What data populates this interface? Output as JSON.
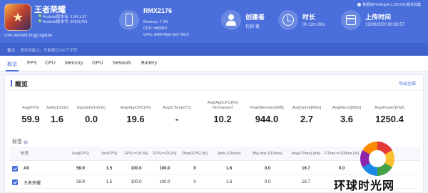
{
  "header": {
    "app": {
      "name": "王者荣耀",
      "android_version": "Android版本名: 1.54.1.37",
      "android_code": "Android版本号: 54011701",
      "package": "com.tencent.tmgp.sgame"
    },
    "device": {
      "model": "RMX2176",
      "memory": "Memory: 7.4G",
      "cpu": "CPU: mt6853",
      "gpu": "GPU: ARM Mali-G57 MC3"
    },
    "creator": {
      "label": "创建者",
      "value": "包剑·客"
    },
    "duration": {
      "label": "时长",
      "value": "0h 12m 36s"
    },
    "upload": {
      "label": "上传时间",
      "value": "13/09/2020 00:30:57"
    },
    "version_note": "数据由PerfDog(4.1.200700)版本收集"
  },
  "remark": {
    "label": "备注",
    "value": "请添加备注，不能超过100个字符"
  },
  "tabs": [
    {
      "label": "概览",
      "active": true
    },
    {
      "label": "FPS"
    },
    {
      "label": "CPU"
    },
    {
      "label": "Memory"
    },
    {
      "label": "GPU"
    },
    {
      "label": "Network"
    },
    {
      "label": "Battery"
    }
  ],
  "overview": {
    "title": "概览",
    "export_label": "导出全部",
    "metrics": [
      {
        "label": "Avg(FPS)",
        "value": "59.9"
      },
      {
        "label": "Jank(/10min)",
        "value": "1.6"
      },
      {
        "label": "BigJank(/10min)",
        "value": "0.0"
      },
      {
        "label": "Avg(AppCPU)[%]",
        "value": "19.6"
      },
      {
        "label": "Avg(CTemp)[°C]",
        "value": "-"
      },
      {
        "label": "Avg(AppCPU)[%] Normalized",
        "value": "10.2"
      },
      {
        "label": "Peak(Memory)[MB]",
        "value": "944.0"
      },
      {
        "label": "Avg(Send)[KB/s]",
        "value": "2.7"
      },
      {
        "label": "Avg(Recv)[KB/s]",
        "value": "3.6"
      },
      {
        "label": "Avg(Power)[mW]",
        "value": "1250.4"
      }
    ],
    "section_label": "标签",
    "table": {
      "headers": [
        "标签",
        "Avg(FPS)",
        "Var(FPS)",
        "FPS>=18 [%]",
        "FPS>=25 [%]",
        "Drop(FPS) [/h]",
        "Jank (/10min)",
        "BigJank (/10min)",
        "Avg(FTime) [ms]",
        "FTime>=100ms [%]"
      ],
      "rows": [
        {
          "name": "All",
          "cells": [
            "59.9",
            "1.5",
            "100.0",
            "100.0",
            "0",
            "1.6",
            "0.0",
            "16.7",
            "0.0"
          ]
        },
        {
          "name": "王者荣耀",
          "cells": [
            "59.9",
            "1.5",
            "100.0",
            "100.0",
            "0",
            "1.6",
            "0.0",
            "16.7",
            "0.0"
          ]
        }
      ]
    }
  },
  "watermark": {
    "text": "环球时光网"
  }
}
